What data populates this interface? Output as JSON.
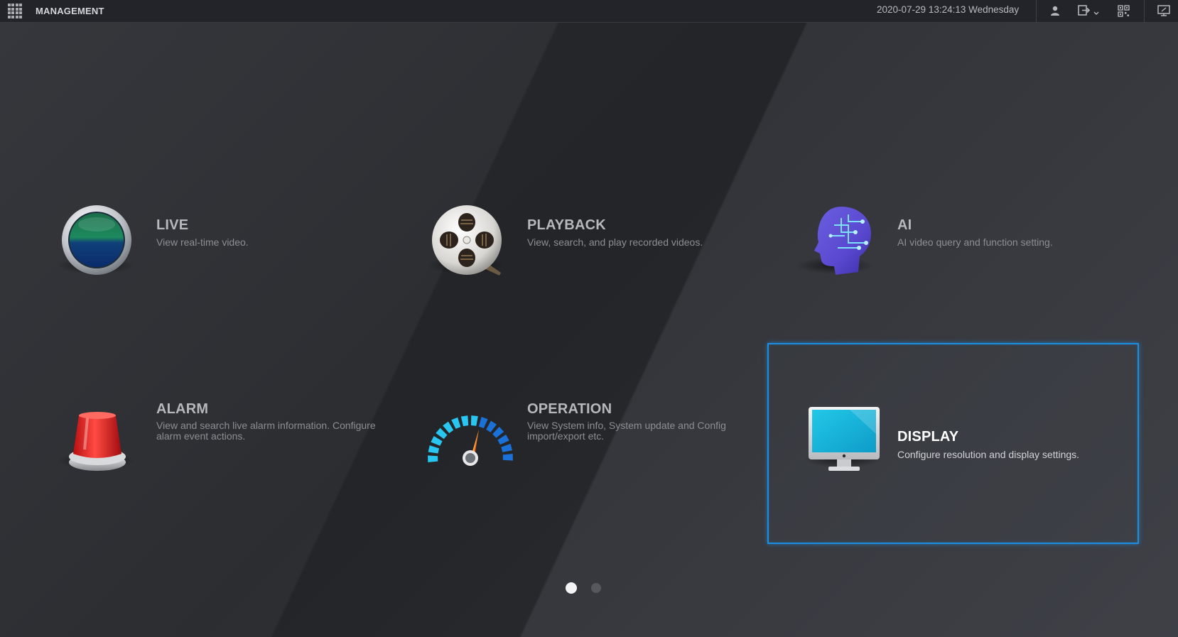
{
  "topbar": {
    "title": "MANAGEMENT",
    "datetime": "2020-07-29 13:24:13 Wednesday",
    "icons": [
      "grid-menu-icon",
      "user-icon",
      "logout-icon",
      "qr-code-icon",
      "monitor-icon"
    ]
  },
  "tiles": [
    {
      "id": "live",
      "title": "LIVE",
      "desc": "View real-time video.",
      "icon": "live-lens-icon",
      "selected": false
    },
    {
      "id": "playback",
      "title": "PLAYBACK",
      "desc": "View, search, and play recorded videos.",
      "icon": "film-reel-icon",
      "selected": false
    },
    {
      "id": "ai",
      "title": "AI",
      "desc": "AI video query and function setting.",
      "icon": "ai-head-icon",
      "selected": false
    },
    {
      "id": "alarm",
      "title": "ALARM",
      "desc_line1": "View and search live alarm information. Configure",
      "desc_line2": "alarm event actions.",
      "icon": "alarm-siren-icon",
      "selected": false
    },
    {
      "id": "operation",
      "title": "OPERATION",
      "desc_line1": "View System info, System update and Config",
      "desc_line2": "import/export etc.",
      "icon": "gauge-icon",
      "selected": false
    },
    {
      "id": "display",
      "title": "DISPLAY",
      "desc": "Configure resolution and display settings.",
      "icon": "monitor-display-icon",
      "selected": true
    }
  ],
  "pagination": {
    "current": 1,
    "total": 2
  },
  "colors": {
    "accent": "#1c8ee0",
    "topbar": "#23242a",
    "background": "#2f3034"
  }
}
